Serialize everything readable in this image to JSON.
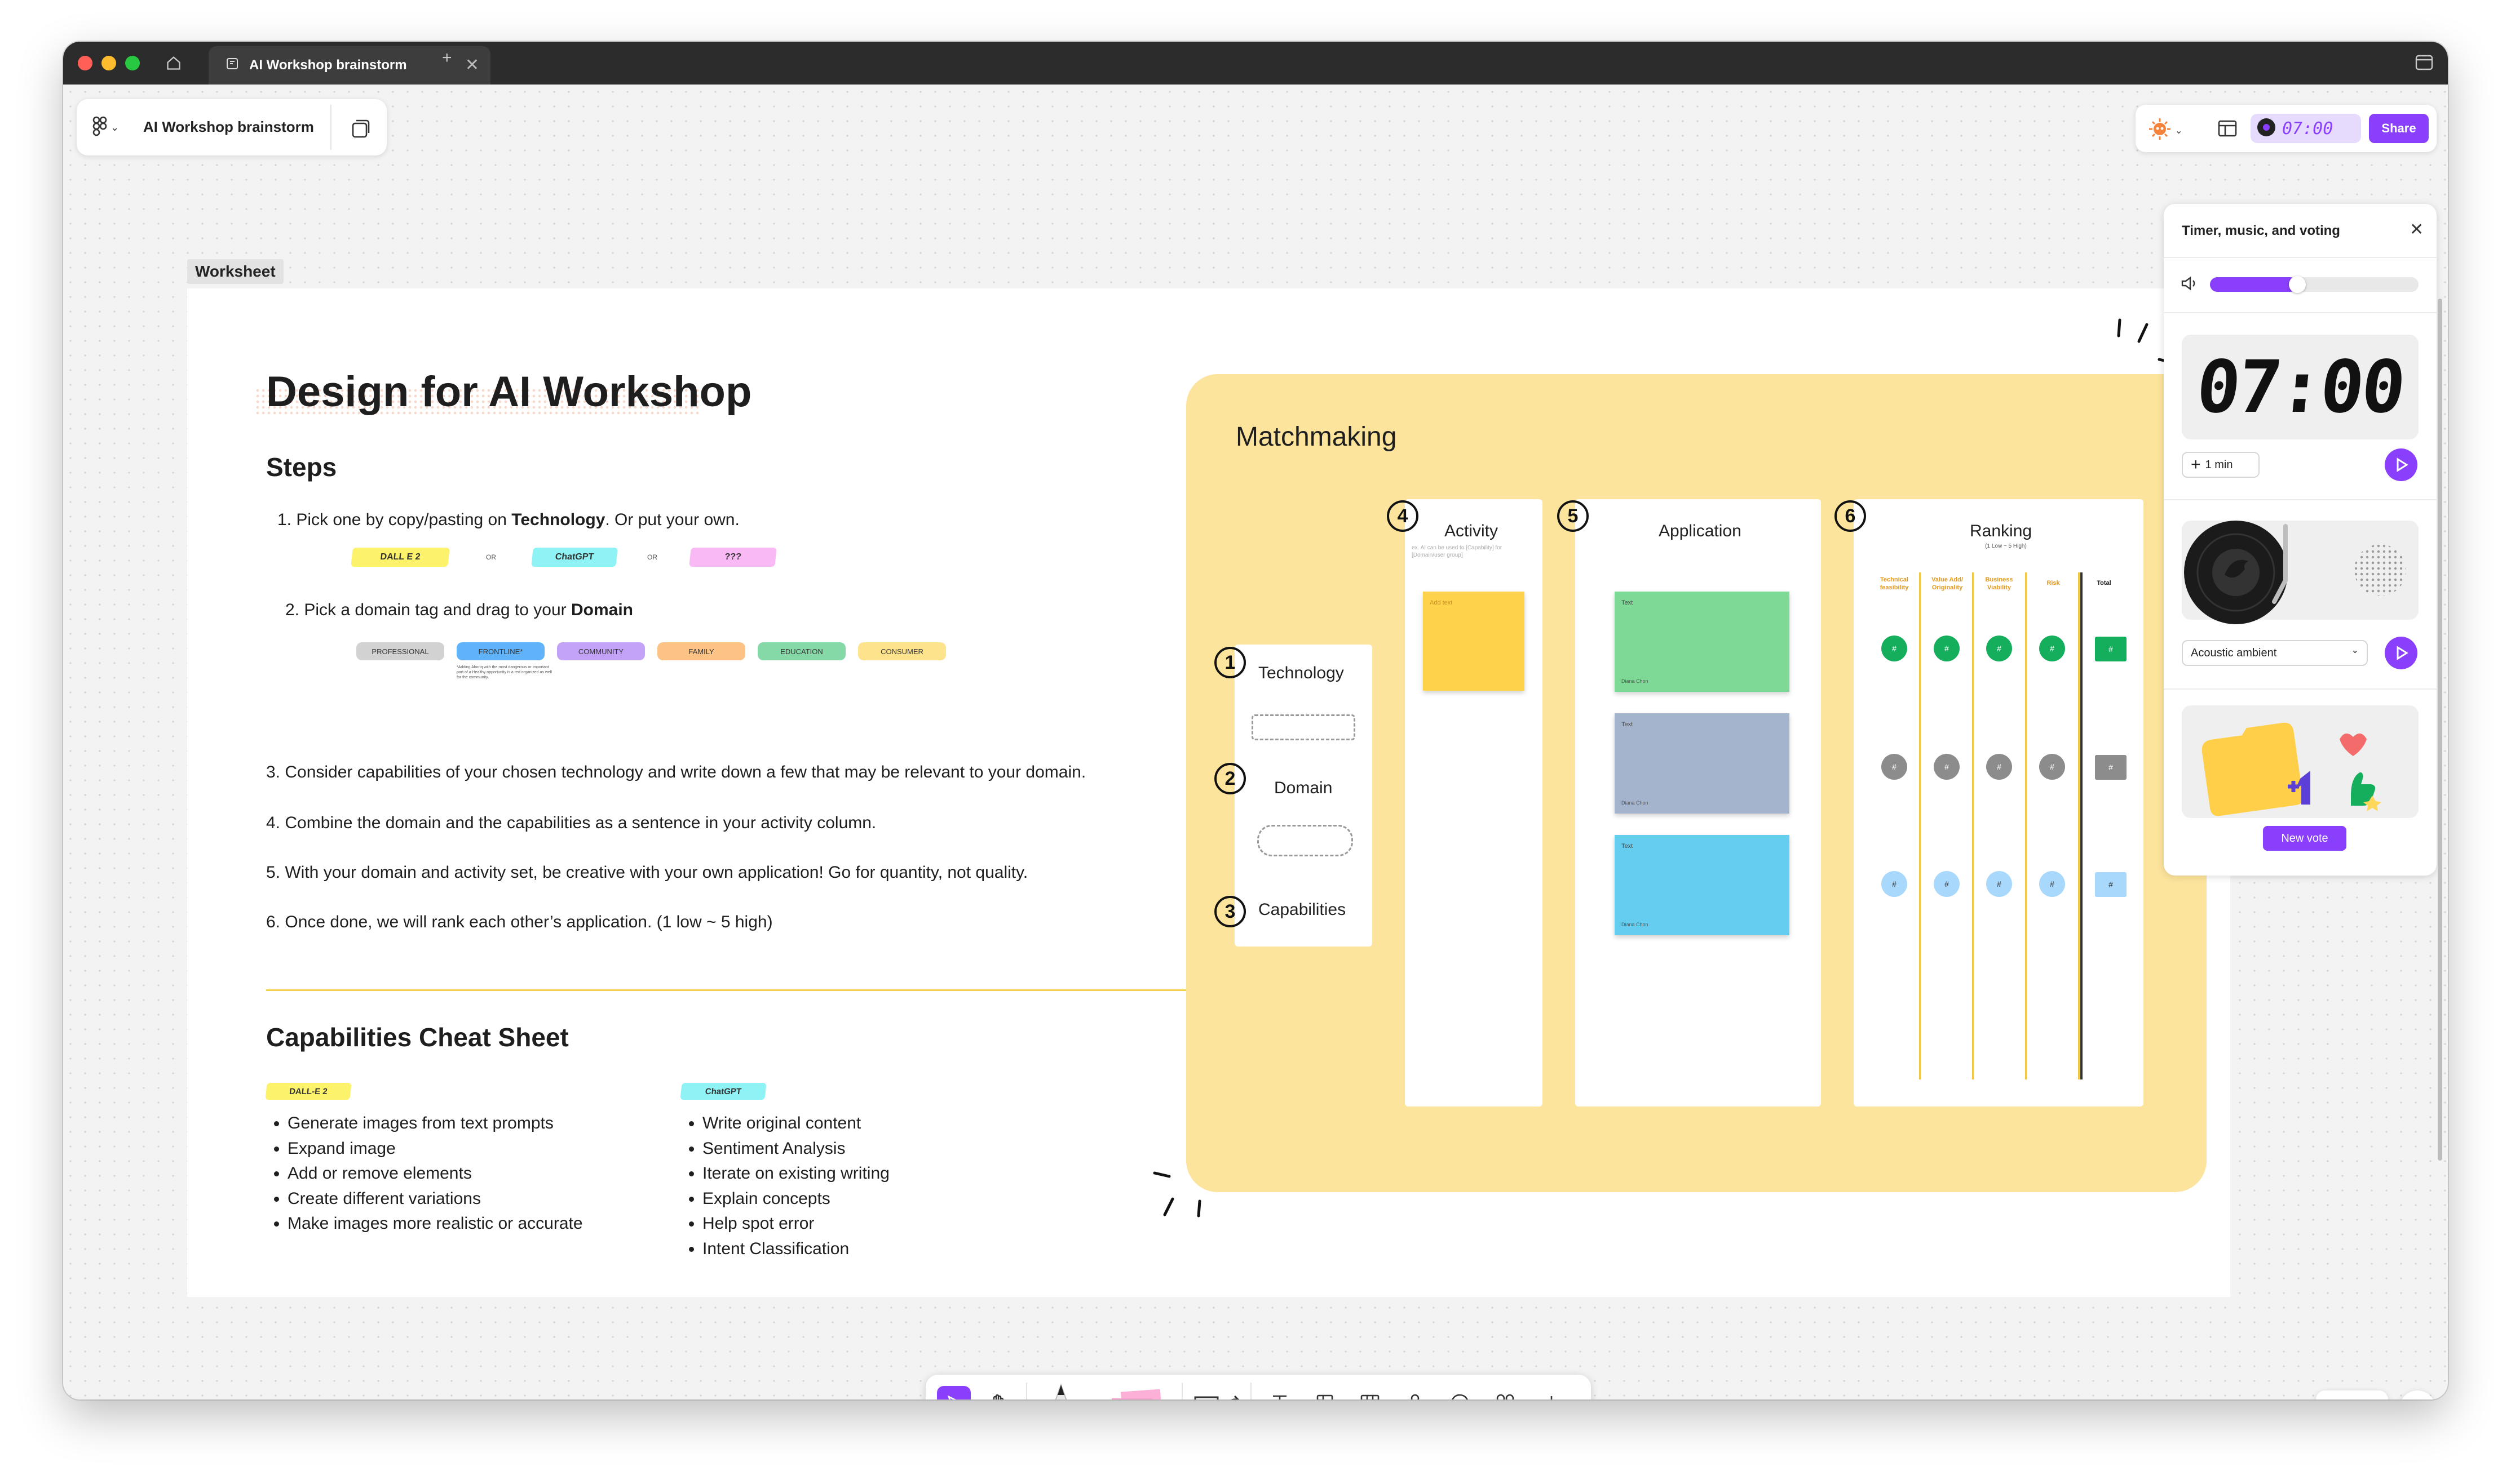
{
  "window": {
    "tab_title": "AI Workshop brainstorm",
    "colors": {
      "titlebar": "#2c2c2c",
      "accent": "#8a3ffc"
    }
  },
  "file": {
    "name": "AI Workshop brainstorm"
  },
  "worksheet": {
    "label": "Worksheet",
    "title": "Design for AI Workshop",
    "steps_heading": "Steps",
    "step1": {
      "prefix": "1. Pick  one by copy/pasting on ",
      "bold": "Technology",
      "suffix": ". Or put your own."
    },
    "tech_tags": [
      "DALL E 2",
      "ChatGPT",
      "???"
    ],
    "or_text": "OR",
    "step2": {
      "prefix": "2. Pick a domain tag and drag to your ",
      "bold": "Domain"
    },
    "domain_tags": [
      "PROFESSIONAL",
      "FRONTLINE*",
      "COMMUNITY",
      "FAMILY",
      "EDUCATION",
      "CONSUMER"
    ],
    "frontline_note": "*Adding Aboriq with the most dangerous or important part of a Healthy opportunity is a red organized as well for the community.",
    "step3": "3. Consider capabilities of your chosen technology and write down a few that may be relevant to your domain.",
    "step4": "4. Combine the domain and the capabilities as a sentence in your activity column.",
    "step5": "5. With your domain and activity set, be creative with your own application! Go for quantity, not quality.",
    "step6": "6. Once done, we will rank each other’s application. (1 low ~ 5 high)",
    "cheat_heading": "Capabilities Cheat Sheet",
    "dalle_tag": "DALL-E 2",
    "chatgpt_tag": "ChatGPT",
    "dalle_items": [
      "Generate images from text prompts",
      "Expand image",
      "Add or remove elements",
      "Create different variations",
      "Make images more realistic or accurate"
    ],
    "chatgpt_items": [
      "Write original content",
      "Sentiment Analysis",
      "Iterate on existing writing",
      "Explain concepts",
      "Help spot error",
      "Intent Classification"
    ]
  },
  "matchmaking": {
    "title": "Matchmaking",
    "numbers": [
      "1",
      "2",
      "3",
      "4",
      "5",
      "6"
    ],
    "left_labels": [
      "Technology",
      "Domain",
      "Capabilities"
    ],
    "activity": {
      "title": "Activity",
      "hint": "ex. AI can be used to [Capability] for [Domain/user group]",
      "sticky_text": "Add text"
    },
    "application": {
      "title": "Application",
      "sticky_text": "Text",
      "sticky_author": "Diana Chon"
    },
    "ranking": {
      "title": "Ranking",
      "subtitle": "(1 Low ~ 5 High)",
      "headers": [
        "Technical feasibility",
        "Value Add/ Originality",
        "Business Viability",
        "Risk",
        "Total"
      ],
      "cell": "#"
    }
  },
  "top_right": {
    "timer": "07:00",
    "share_label": "Share"
  },
  "panel": {
    "title": "Timer, music, and voting",
    "volume": 0.42,
    "timer_display": "07:00",
    "add_min": "1 min",
    "music_option": "Acoustic ambient",
    "new_vote": "New vote"
  },
  "toolbar": {
    "icons": [
      "cursor-icon",
      "hand-icon",
      "pen-icon",
      "sticky-icon",
      "shape-icon",
      "connector-icon",
      "text-icon",
      "section-icon",
      "table-icon",
      "stamp-icon",
      "comment-icon",
      "widgets-icon",
      "plus-icon"
    ]
  },
  "zoom": {
    "minus": "−",
    "plus": "+",
    "help": "?"
  }
}
